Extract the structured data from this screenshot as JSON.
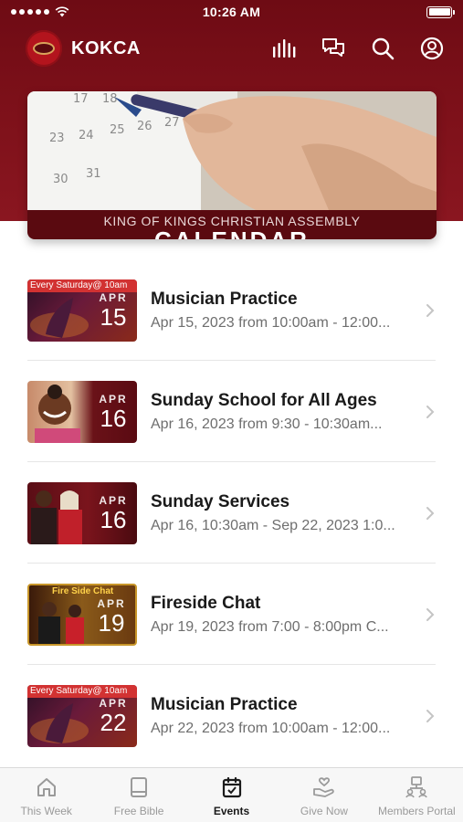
{
  "status_bar": {
    "time": "10:26 AM"
  },
  "header": {
    "title": "KOKCA"
  },
  "banner": {
    "caption": "KING OF KINGS CHRISTIAN ASSEMBLY",
    "word": "CALENDAR"
  },
  "events": [
    {
      "title": "Musician Practice",
      "subtitle": "Apr 15, 2023 from 10:00am - 12:00...",
      "month": "APR",
      "day": "15",
      "tag": "Every Saturday@ 10am"
    },
    {
      "title": "Sunday School for All Ages",
      "subtitle": "Apr 16, 2023 from 9:30 - 10:30am...",
      "month": "APR",
      "day": "16",
      "tag": ""
    },
    {
      "title": "Sunday Services",
      "subtitle": "Apr 16, 10:30am - Sep 22, 2023 1:0...",
      "month": "APR",
      "day": "16",
      "tag": ""
    },
    {
      "title": "Fireside Chat",
      "subtitle": "Apr 19, 2023 from 7:00 - 8:00pm C...",
      "month": "APR",
      "day": "19",
      "tag": "Fire Side Chat"
    },
    {
      "title": "Musician Practice",
      "subtitle": "Apr 22, 2023 from 10:00am - 12:00...",
      "month": "APR",
      "day": "22",
      "tag": "Every Saturday@ 10am"
    }
  ],
  "tabs": [
    {
      "label": "This Week",
      "icon": "home-icon",
      "active": false
    },
    {
      "label": "Free Bible",
      "icon": "book-icon",
      "active": false
    },
    {
      "label": "Events",
      "icon": "calendar-icon",
      "active": true
    },
    {
      "label": "Give Now",
      "icon": "give-hand-icon",
      "active": false
    },
    {
      "label": "Members Portal",
      "icon": "members-icon",
      "active": false
    }
  ],
  "colors": {
    "brand_red": "#7c1019",
    "text_primary": "#1a1a1a",
    "text_secondary": "#6e6e6e",
    "tab_inactive": "#9a9a9a"
  }
}
